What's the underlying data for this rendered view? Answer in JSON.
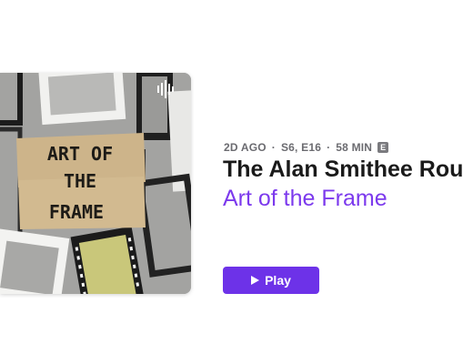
{
  "episode": {
    "artwork": {
      "title_lines": [
        "ART OF",
        "THE",
        "FRAME"
      ],
      "logo_icon": "anchor-podcast-waveform-icon"
    },
    "meta": {
      "age": "2D AGO",
      "separator": "·",
      "season_episode": "S6, E16",
      "duration": "58 MIN",
      "explicit_badge": "E"
    },
    "show_title": "The Alan Smithee Rou",
    "episode_title": "Art of the Frame",
    "play_button": {
      "label": "Play",
      "icon": "play-icon"
    }
  },
  "colors": {
    "accent": "#6d32e8",
    "episode_title": "#7c3aed",
    "meta_text": "#6b6b70"
  }
}
